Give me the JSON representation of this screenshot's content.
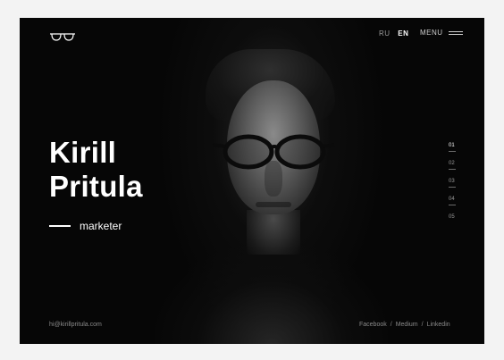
{
  "header": {
    "logo_icon": "glasses-icon",
    "languages": [
      {
        "code": "RU",
        "active": false
      },
      {
        "code": "EN",
        "active": true
      }
    ],
    "menu_label": "MENU",
    "menu_icon": "hamburger-icon"
  },
  "hero": {
    "first_name": "Kirill",
    "last_name": "Pritula",
    "role": "marketer"
  },
  "pager": [
    "01",
    "02",
    "03",
    "04",
    "05"
  ],
  "footer": {
    "email": "hi@kirillpritula.com",
    "social": [
      "Facebook",
      "Medium",
      "Linkedin"
    ],
    "separator": "/"
  },
  "colors": {
    "background": "#060606",
    "text_primary": "#ffffff",
    "text_muted": "#8a8a8a"
  }
}
